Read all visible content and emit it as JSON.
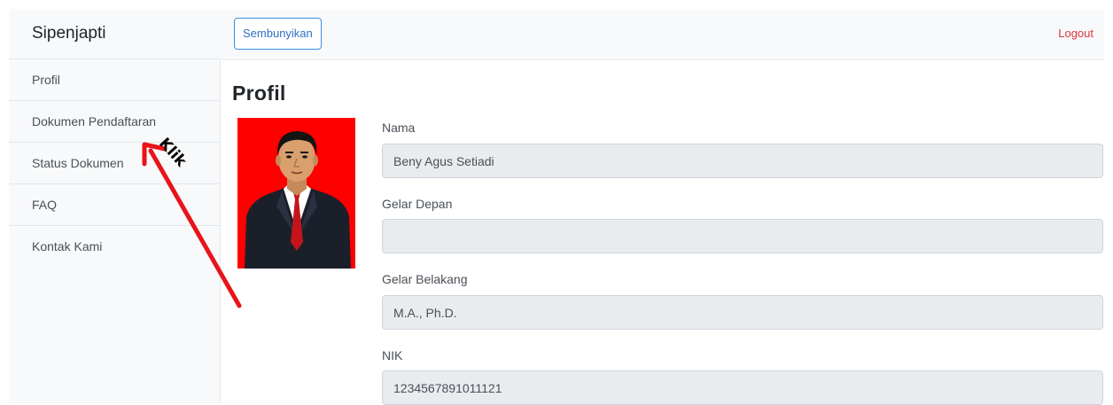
{
  "sidebar": {
    "brand": "Sipenjapti",
    "items": [
      {
        "label": "Profil"
      },
      {
        "label": "Dokumen Pendaftaran"
      },
      {
        "label": "Status Dokumen"
      },
      {
        "label": "FAQ"
      },
      {
        "label": "Kontak Kami"
      }
    ]
  },
  "topbar": {
    "hide_label": "Sembunyikan",
    "logout_label": "Logout"
  },
  "main": {
    "title": "Profil",
    "fields": [
      {
        "label": "Nama",
        "value": "Beny Agus Setiadi"
      },
      {
        "label": "Gelar Depan",
        "value": ""
      },
      {
        "label": "Gelar Belakang",
        "value": "M.A., Ph.D."
      },
      {
        "label": "NIK",
        "value": "1234567891011121"
      }
    ]
  },
  "annotation": {
    "text": "Klik",
    "color": "#e8141a"
  },
  "colors": {
    "logout": "#dc3545",
    "photo_background": "#ff0000",
    "button_border": "#3b8fe0"
  }
}
